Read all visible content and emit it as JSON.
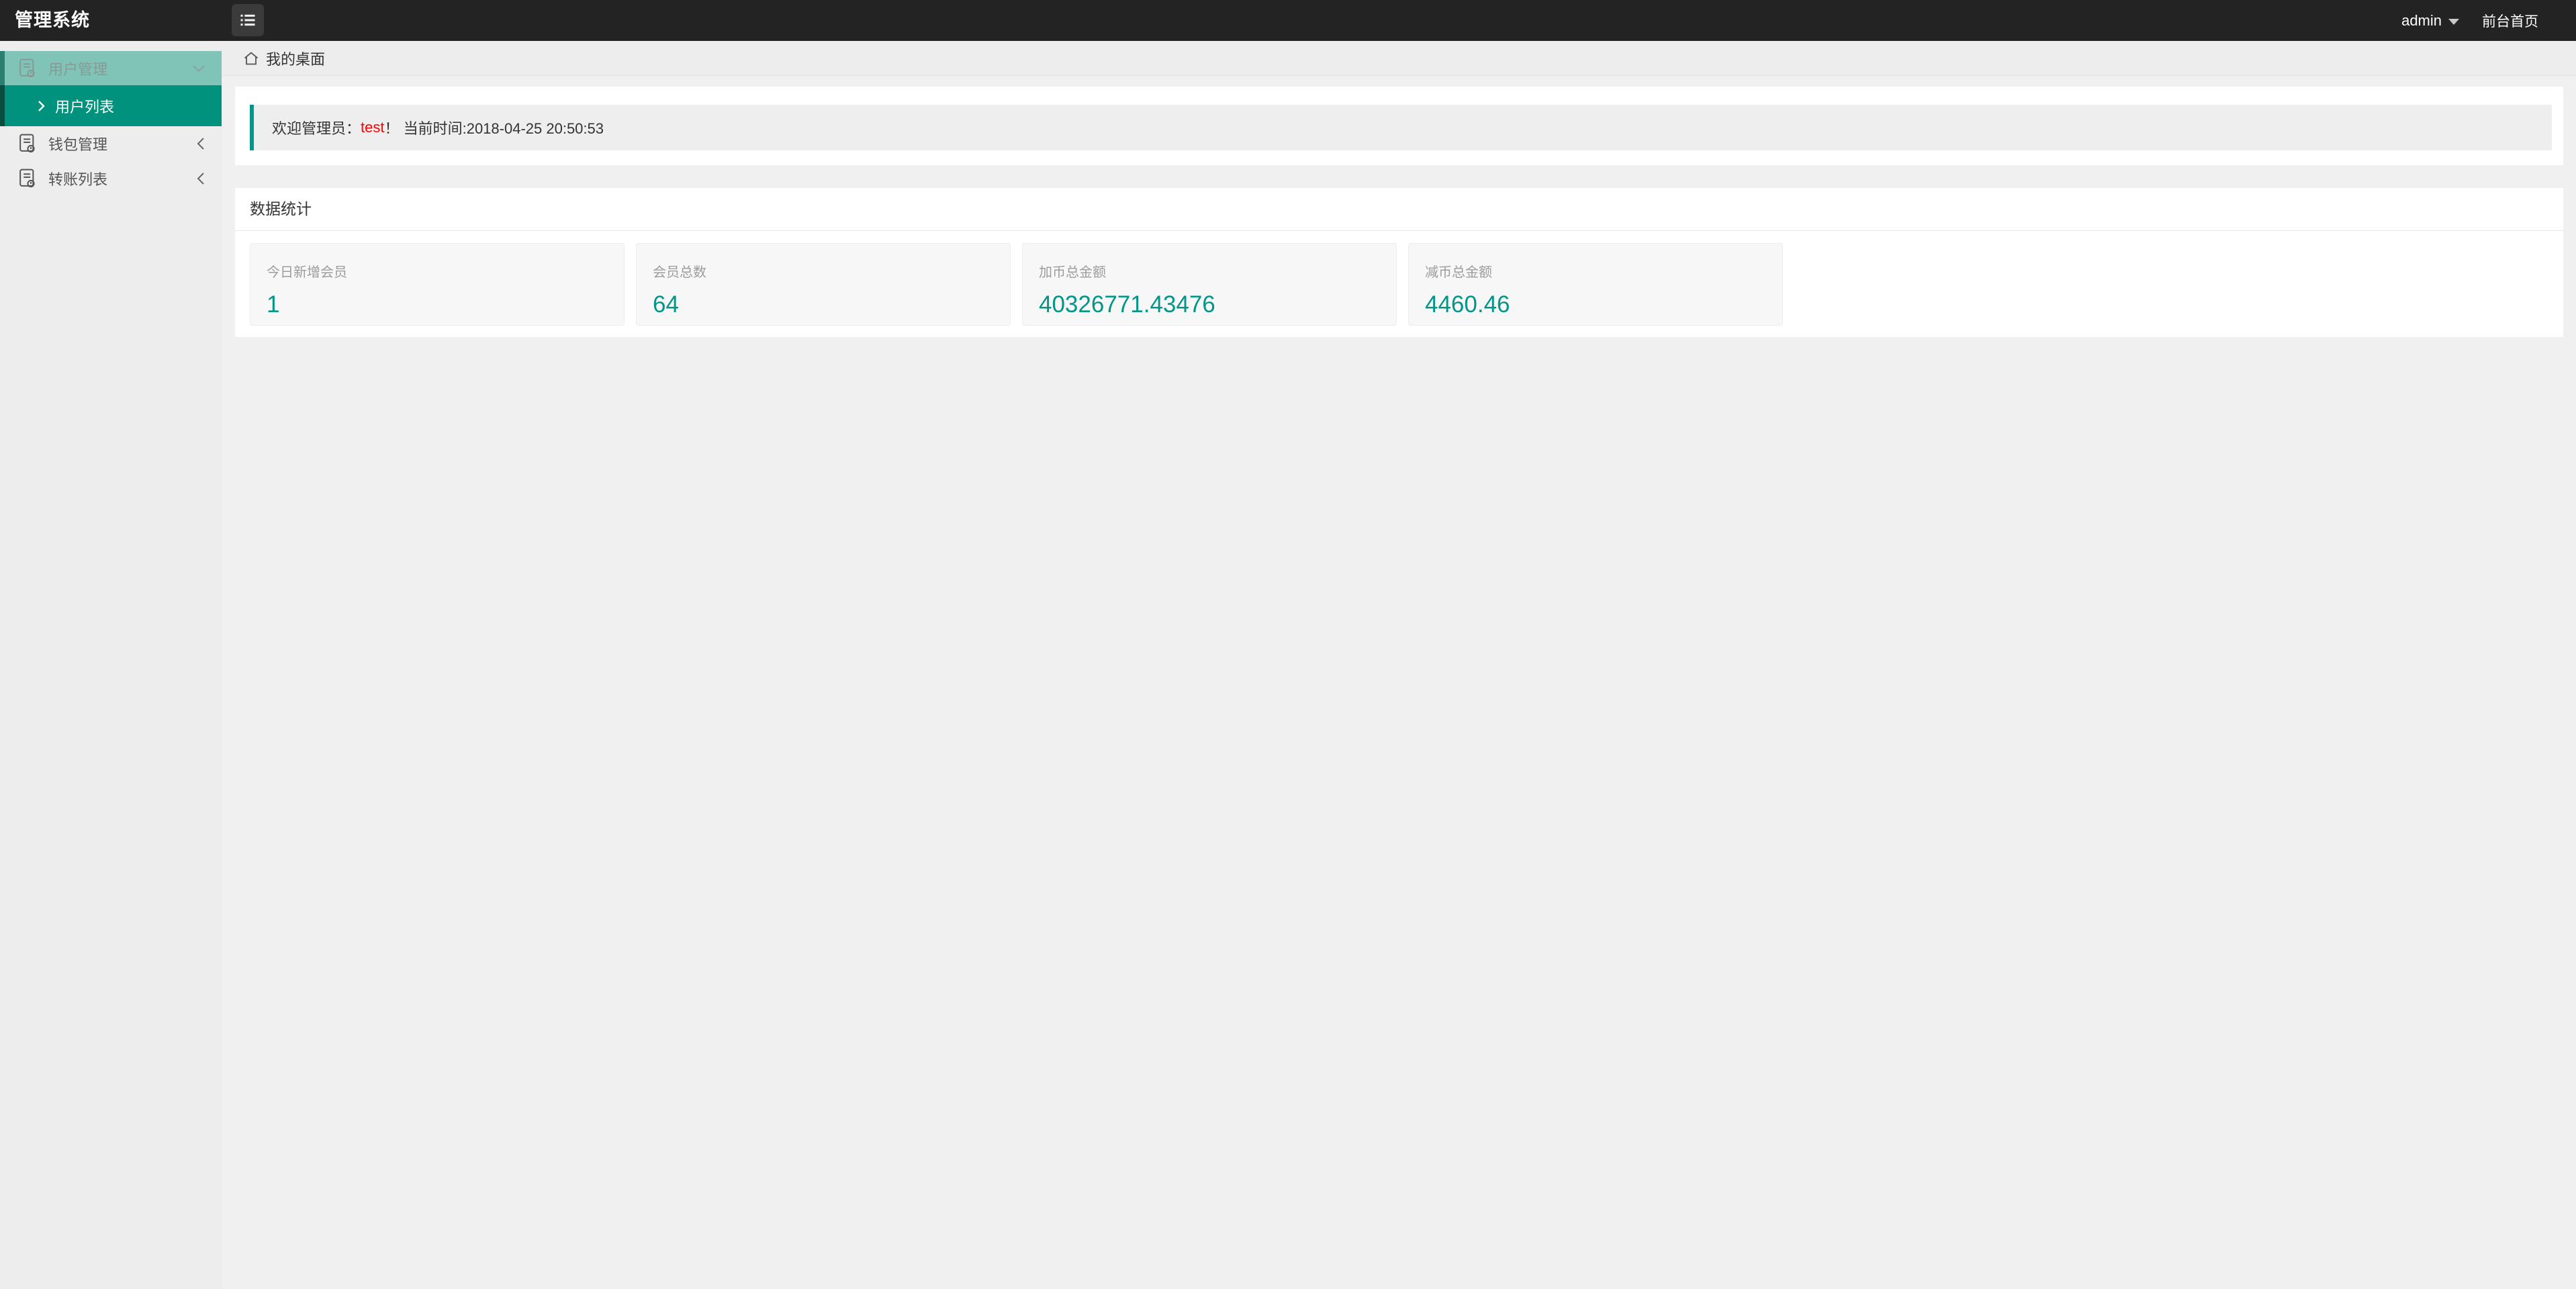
{
  "colors": {
    "topbar_bg": "#232323",
    "accent_teal": "#009688",
    "menu_active_bg": "#00927d",
    "menu_parent_bg": "#7fc4b7",
    "username_red": "#ff0000",
    "page_bg": "#f0f0f0"
  },
  "topbar": {
    "title": "管理系统",
    "menu_toggle_icon": "list-icon",
    "user": "admin",
    "user_caret_icon": "caret-down-icon",
    "frontend_link": "前台首页"
  },
  "sidebar": {
    "groups": [
      {
        "label": "用户管理",
        "icon": "document-icon",
        "chevron": "chevron-down-icon",
        "expanded": true,
        "items": [
          {
            "label": "用户列表",
            "icon": "arrow-right-icon",
            "active": true
          }
        ]
      },
      {
        "label": "钱包管理",
        "icon": "document-icon",
        "chevron": "chevron-left-icon",
        "expanded": false,
        "items": []
      },
      {
        "label": "转账列表",
        "icon": "document-icon",
        "chevron": "chevron-left-icon",
        "expanded": false,
        "items": []
      }
    ]
  },
  "breadcrumb": {
    "icon": "home-icon",
    "current": "我的桌面"
  },
  "welcome": {
    "prefix": "欢迎管理员：",
    "username": "test",
    "suffix": "！ 当前时间:2018-04-25 20:50:53"
  },
  "stats": {
    "title": "数据统计",
    "cards": [
      {
        "label": "今日新增会员",
        "value": "1"
      },
      {
        "label": "会员总数",
        "value": "64"
      },
      {
        "label": "加币总金额",
        "value": "40326771.43476"
      },
      {
        "label": "减币总金额",
        "value": "4460.46"
      }
    ]
  }
}
